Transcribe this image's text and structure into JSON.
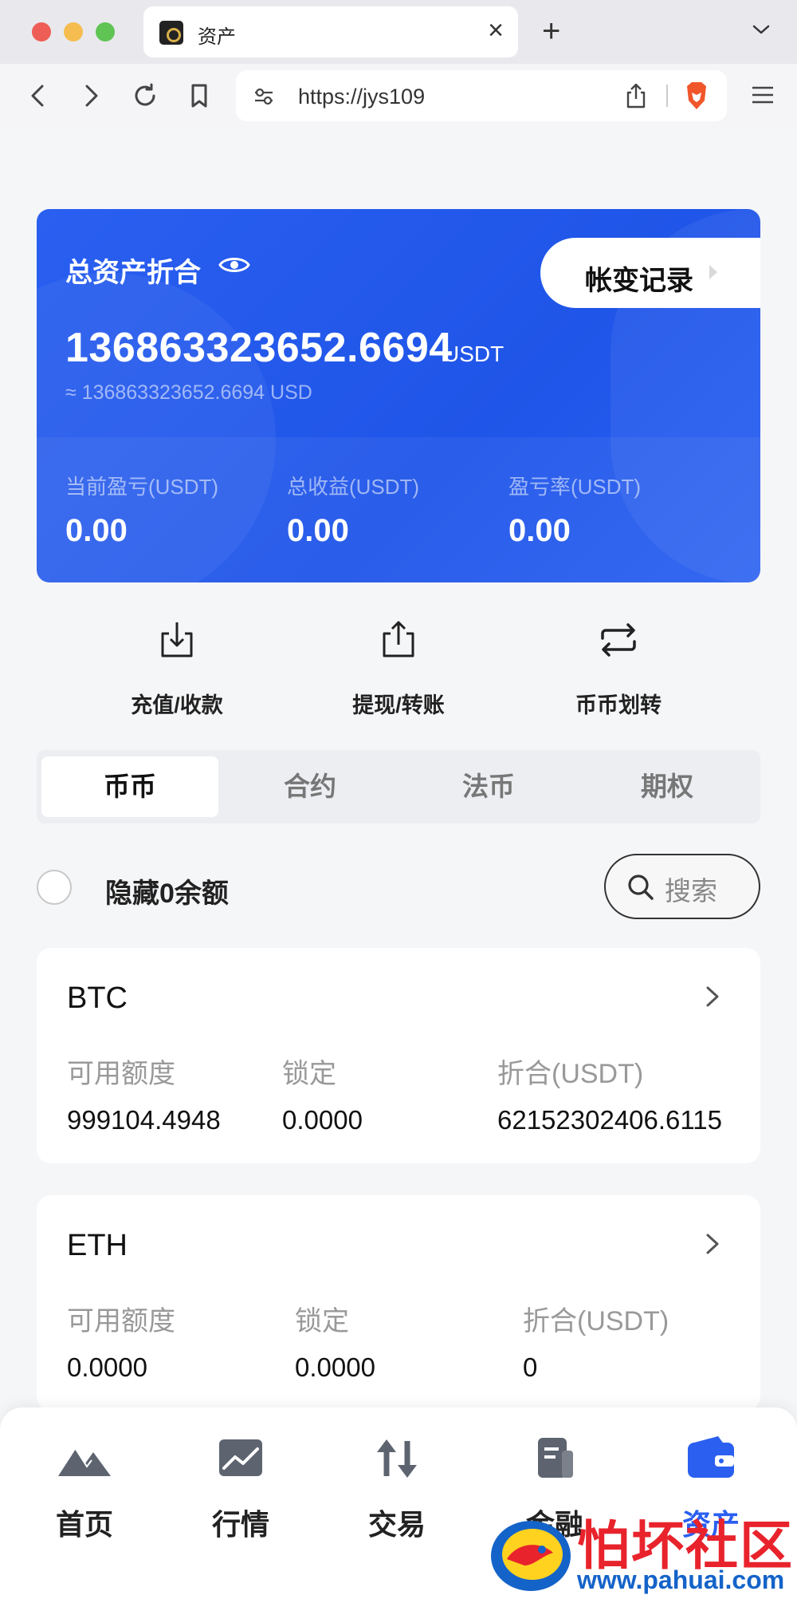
{
  "browser": {
    "tab_title": "资产",
    "tab_close": "×",
    "new_tab": "+",
    "url": "https://jys109"
  },
  "asset_card": {
    "label": "总资产折合",
    "history_button": "帐变记录",
    "total_value": "136863323652.6694",
    "total_unit": "USDT",
    "total_usd": "≈ 136863323652.6694 USD",
    "stats": [
      {
        "label": "当前盈亏(USDT)",
        "value": "0.00"
      },
      {
        "label": "总收益(USDT)",
        "value": "0.00"
      },
      {
        "label": "盈亏率(USDT)",
        "value": "0.00"
      }
    ]
  },
  "actions": [
    {
      "label": "充值/收款",
      "icon": "download-icon"
    },
    {
      "label": "提现/转账",
      "icon": "upload-icon"
    },
    {
      "label": "币币划转",
      "icon": "transfer-icon"
    }
  ],
  "tabs": [
    {
      "label": "币币",
      "active": true
    },
    {
      "label": "合约",
      "active": false
    },
    {
      "label": "法币",
      "active": false
    },
    {
      "label": "期权",
      "active": false
    }
  ],
  "filter": {
    "hide_zero_label": "隐藏0余额",
    "search_label": "搜索"
  },
  "coins": [
    {
      "name": "BTC",
      "columns": [
        {
          "label": "可用额度",
          "value": "999104.4948"
        },
        {
          "label": "锁定",
          "value": "0.0000"
        },
        {
          "label": "折合(USDT)",
          "value": "62152302406.6115"
        }
      ]
    },
    {
      "name": "ETH",
      "columns": [
        {
          "label": "可用额度",
          "value": "0.0000"
        },
        {
          "label": "锁定",
          "value": "0.0000"
        },
        {
          "label": "折合(USDT)",
          "value": "0"
        }
      ]
    }
  ],
  "bottom_nav": [
    {
      "label": "首页",
      "icon": "home-mountain-icon"
    },
    {
      "label": "行情",
      "icon": "chart-icon"
    },
    {
      "label": "交易",
      "icon": "trade-arrows-icon"
    },
    {
      "label": "金融",
      "icon": "finance-doc-icon"
    },
    {
      "label": "资产",
      "icon": "wallet-icon",
      "active": true
    }
  ],
  "watermark": {
    "brand": "怕坏社区",
    "url": "www.pahuai.com"
  },
  "colors": {
    "accent": "#2a5ff0",
    "watermark_red": "#e8232c",
    "watermark_blue": "#1463c9"
  }
}
